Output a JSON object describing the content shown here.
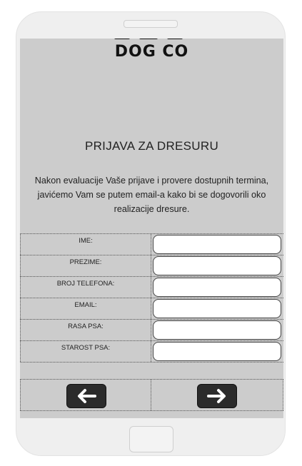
{
  "brand": {
    "name": "DOG CO"
  },
  "page": {
    "title": "PRIJAVA ZA DRESURU",
    "intro": "Nakon evaluacije Vaše prijave i provere dostupnih termina, javićemo Vam se putem email-a kako bi se dogovorili oko realizacije dresure."
  },
  "form": {
    "fields": [
      {
        "label": "IME:",
        "value": ""
      },
      {
        "label": "PREZIME:",
        "value": ""
      },
      {
        "label": "BROJ TELEFONA:",
        "value": ""
      },
      {
        "label": "EMAIL:",
        "value": ""
      },
      {
        "label": "RASA PSA:",
        "value": ""
      },
      {
        "label": "STAROST PSA:",
        "value": ""
      }
    ]
  },
  "nav": {
    "back_icon": "arrow-left-icon",
    "next_icon": "arrow-right-icon"
  },
  "colors": {
    "screen": "#cccccc",
    "button": "#2b2b2b",
    "frame": "#efefef"
  }
}
